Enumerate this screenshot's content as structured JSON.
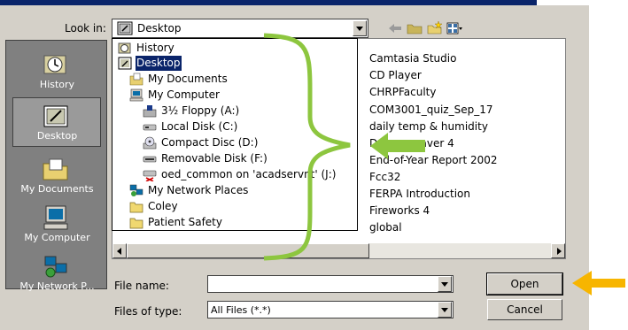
{
  "look_in": {
    "label": "Look in:",
    "value": "Desktop"
  },
  "places": [
    {
      "label": "History",
      "icon": "history-icon"
    },
    {
      "label": "Desktop",
      "icon": "desktop-icon",
      "selected": true
    },
    {
      "label": "My Documents",
      "icon": "my-documents-icon"
    },
    {
      "label": "My Computer",
      "icon": "my-computer-icon"
    },
    {
      "label": "My Network P...",
      "icon": "network-places-icon"
    }
  ],
  "dropdown_items": [
    {
      "label": "History",
      "icon": "history-icon"
    },
    {
      "label": "Desktop",
      "icon": "desktop-icon",
      "highlight": true
    },
    {
      "label": "My Documents",
      "icon": "my-documents-icon"
    },
    {
      "label": "My Computer",
      "icon": "my-computer-icon"
    },
    {
      "label": "3½ Floppy (A:)",
      "icon": "floppy-icon"
    },
    {
      "label": "Local Disk (C:)",
      "icon": "local-disk-icon"
    },
    {
      "label": "Compact Disc (D:)",
      "icon": "cd-icon"
    },
    {
      "label": "Removable Disk (F:)",
      "icon": "removable-disk-icon"
    },
    {
      "label": "oed_common on 'acadservnt' (J:)",
      "icon": "network-drive-icon"
    },
    {
      "label": "My Network Places",
      "icon": "network-places-icon"
    },
    {
      "label": "Coley",
      "icon": "folder-icon"
    },
    {
      "label": "Patient Safety",
      "icon": "folder-icon"
    }
  ],
  "files": [
    "Camtasia Studio",
    "CD Player",
    "CHRPFaculty",
    "COM3001_quiz_Sep_17",
    "daily temp & humidity",
    "Dreamweaver 4",
    "End-of-Year Report 2002",
    "Fcc32",
    "FERPA Introduction",
    "Fireworks 4",
    "global"
  ],
  "file_name": {
    "label": "File name:",
    "value": ""
  },
  "files_of_type": {
    "label": "Files of type:",
    "value": "All Files (*.*)"
  },
  "buttons": {
    "open": "Open",
    "cancel": "Cancel"
  },
  "colors": {
    "annotation_green": "#8dc63f",
    "annotation_yellow": "#f7b500",
    "highlight": "#0a246a"
  }
}
